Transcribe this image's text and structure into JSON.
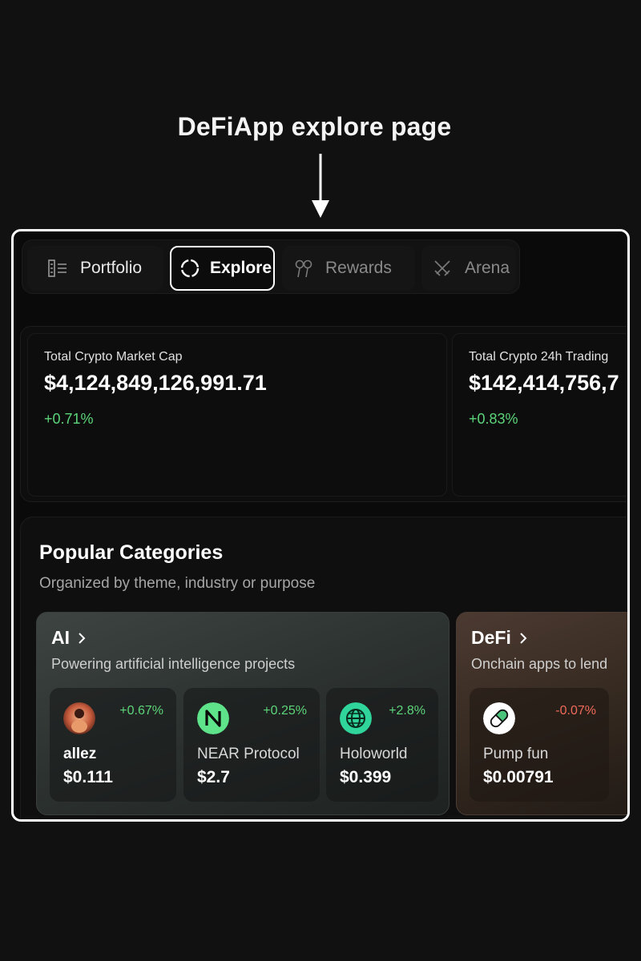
{
  "caption": "DeFiApp explore page",
  "nav": {
    "tabs": [
      {
        "label": "Portfolio",
        "icon": "portfolio-list-icon"
      },
      {
        "label": "Explore",
        "icon": "explore-compass-icon",
        "active": true
      },
      {
        "label": "Rewards",
        "icon": "rewards-icon"
      },
      {
        "label": "Arena",
        "icon": "arena-swords-icon"
      }
    ]
  },
  "stats": [
    {
      "label": "Total Crypto Market Cap",
      "value": "$4,124,849,126,991.71",
      "change": "+0.71%"
    },
    {
      "label": "Total Crypto 24h Trading",
      "value": "$142,414,756,7",
      "change": "+0.83%"
    }
  ],
  "categories": {
    "title": "Popular Categories",
    "subtitle": "Organized by theme, industry or purpose",
    "items": [
      {
        "name": "AI",
        "description": "Powering artificial intelligence projects",
        "tokens": [
          {
            "name": "allez",
            "price": "$0.111",
            "change": "+0.67%"
          },
          {
            "name": "NEAR Protocol",
            "price": "$2.7",
            "change": "+0.25%"
          },
          {
            "name": "Holoworld",
            "price": "$0.399",
            "change": "+2.8%"
          }
        ]
      },
      {
        "name": "DeFi",
        "description": "Onchain apps to lend",
        "tokens": [
          {
            "name": "Pump fun",
            "price": "$0.00791",
            "change": "-0.07%"
          }
        ]
      }
    ]
  },
  "colors": {
    "positive": "#5dd57a",
    "negative": "#ef6a5a",
    "near_icon": "#5ee28a",
    "holo_icon": "#2fd59a"
  }
}
